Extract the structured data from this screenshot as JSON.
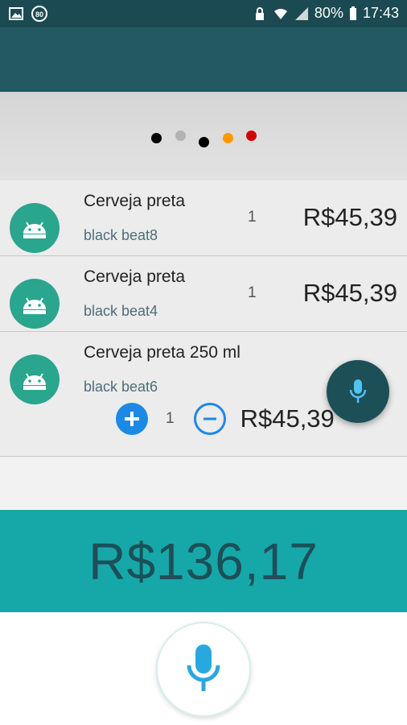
{
  "status_bar": {
    "battery": "80%",
    "time": "17:43",
    "notification_badge": "80",
    "icons": [
      "gallery-icon",
      "badge-icon",
      "lock-icon",
      "wifi-icon",
      "signal-icon",
      "battery-icon"
    ]
  },
  "page_dots": [
    {
      "color": "#000000"
    },
    {
      "color": "#b3b3b3"
    },
    {
      "color": "#000000"
    },
    {
      "color": "#ff9800"
    },
    {
      "color": "#d50000"
    }
  ],
  "items": [
    {
      "name": "Cerveja preta",
      "subtitle": "black beat8",
      "quantity": "1",
      "price": "R$45,39"
    },
    {
      "name": "Cerveja preta",
      "subtitle": "black beat4",
      "quantity": "1",
      "price": "R$45,39"
    },
    {
      "name": "Cerveja preta 250 ml",
      "subtitle": "black beat6",
      "quantity": "1",
      "price": "R$45,39"
    }
  ],
  "total": "R$136,17",
  "colors": {
    "primary_dark": "#1c4a52",
    "primary": "#235a62",
    "accent": "#16a7a9",
    "avatar": "#2aa58e",
    "control_blue": "#1e88e5"
  }
}
